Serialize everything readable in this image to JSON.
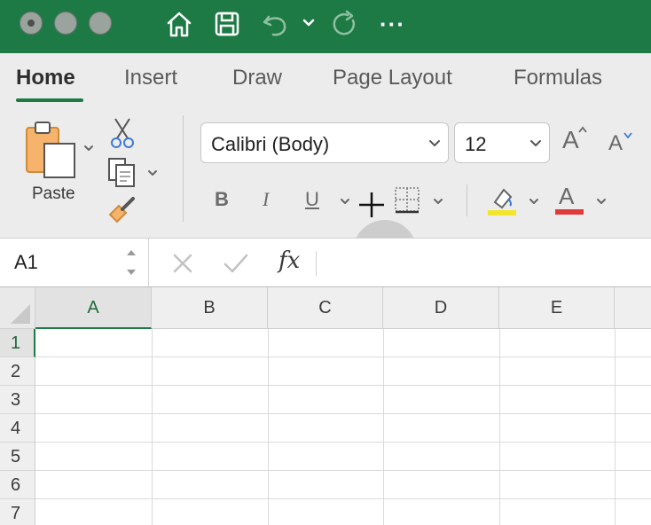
{
  "titlebar": {
    "icons": [
      "home-icon",
      "save-icon",
      "undo-icon",
      "chevron-down-icon",
      "redo-icon",
      "more-icon"
    ],
    "more_label": "···"
  },
  "ribbon": {
    "tabs": [
      {
        "label": "Home",
        "active": true
      },
      {
        "label": "Insert",
        "active": false
      },
      {
        "label": "Draw",
        "active": false
      },
      {
        "label": "Page Layout",
        "active": false
      },
      {
        "label": "Formulas",
        "active": false
      }
    ],
    "paste_label": "Paste",
    "font_name": "Calibri (Body)",
    "font_size": "12",
    "bold_label": "B",
    "italic_label": "I",
    "underline_label": "U",
    "grow_label": "A",
    "shrink_label": "A",
    "font_color_label": "A",
    "colors": {
      "accent": "#1e7a45",
      "highlight": "#f2e52b",
      "font_color": "#e03a3a"
    }
  },
  "formula_bar": {
    "cell_ref": "A1",
    "fx_label": "fx",
    "value": ""
  },
  "grid": {
    "columns": [
      "A",
      "B",
      "C",
      "D",
      "E"
    ],
    "rows": [
      "1",
      "2",
      "3",
      "4",
      "5",
      "6",
      "7"
    ],
    "selected_cell": "A1"
  }
}
